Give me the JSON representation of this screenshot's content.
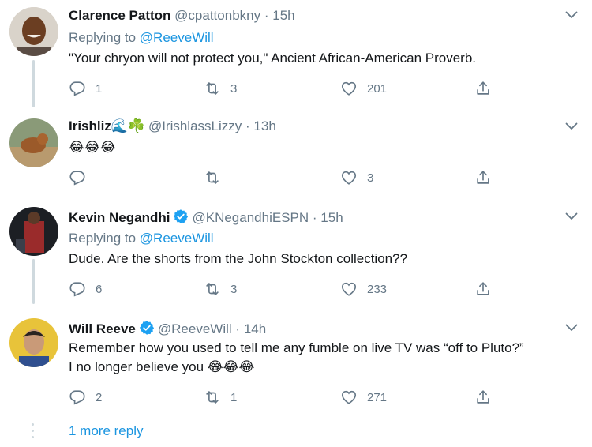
{
  "colors": {
    "accent": "#1b95e0",
    "muted": "#657786",
    "text": "#14171a",
    "verified": "#1da1f2"
  },
  "tweets": [
    {
      "name": "Clarence Patton",
      "handle": "@cpattonbkny",
      "sep": "·",
      "time": "15h",
      "reply_label": "Replying to",
      "reply_mention": "@ReeveWill",
      "text": "\"Your chryon will not protect you,\" Ancient African-American Proverb.",
      "replies": "1",
      "retweets": "3",
      "likes": "201"
    },
    {
      "name": "Irishliz",
      "name_emojis": "🌊☘️",
      "handle": "@IrishlassLizzy",
      "sep": "·",
      "time": "13h",
      "text": "😂😂😂",
      "replies": "",
      "retweets": "",
      "likes": "3"
    },
    {
      "name": "Kevin Negandhi",
      "handle": "@KNegandhiESPN",
      "sep": "·",
      "time": "15h",
      "verified": true,
      "reply_label": "Replying to",
      "reply_mention": "@ReeveWill",
      "text": "Dude. Are the shorts from the John Stockton collection??",
      "replies": "6",
      "retweets": "3",
      "likes": "233"
    },
    {
      "name": "Will Reeve",
      "handle": "@ReeveWill",
      "sep": "·",
      "time": "14h",
      "verified": true,
      "text_line1": "Remember how you used to tell me any fumble on live TV was “off to Pluto?”",
      "text_line2": "I no longer believe you",
      "text_emojis": "😂😂😂",
      "replies": "2",
      "retweets": "1",
      "likes": "271"
    }
  ],
  "more_reply": "1 more reply",
  "icons": [
    "reply-icon",
    "retweet-icon",
    "like-icon",
    "share-icon",
    "chevron-down-icon",
    "verified-icon"
  ]
}
